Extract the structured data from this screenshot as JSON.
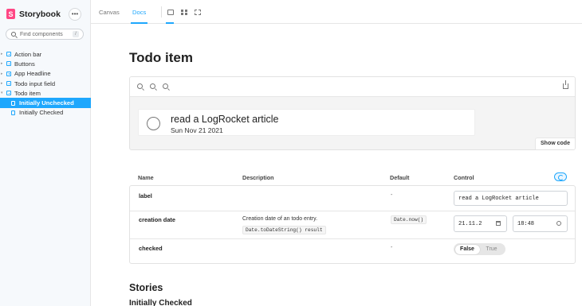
{
  "app": {
    "logo_letter": "S",
    "name": "Storybook",
    "more_label": "•••"
  },
  "search": {
    "placeholder": "Find components",
    "shortcut": "/"
  },
  "sidebar": {
    "items": [
      {
        "label": "Action bar",
        "type": "component"
      },
      {
        "label": "Buttons",
        "type": "component"
      },
      {
        "label": "App Headline",
        "type": "component"
      },
      {
        "label": "Todo input field",
        "type": "component"
      },
      {
        "label": "Todo item",
        "type": "component",
        "expanded": true
      },
      {
        "label": "Initially Unchecked",
        "type": "story",
        "selected": true
      },
      {
        "label": "Initially Checked",
        "type": "story"
      }
    ]
  },
  "toolbar": {
    "tabs": [
      {
        "label": "Canvas"
      },
      {
        "label": "Docs",
        "active": true
      }
    ],
    "tools": [
      "image-icon",
      "grid-icon",
      "outline-icon"
    ]
  },
  "docs": {
    "title": "Todo item",
    "preview": {
      "todo_label": "read a LogRocket article",
      "todo_date": "Sun Nov 21 2021",
      "show_code": "Show code"
    },
    "args": {
      "headers": {
        "name": "Name",
        "description": "Description",
        "default": "Default",
        "control": "Control"
      },
      "rows": [
        {
          "name": "label",
          "description": "",
          "default": "-",
          "control_value": "read a LogRocket article"
        },
        {
          "name": "creation date",
          "description": "Creation date of an todo entry.",
          "description_code": "Date.toDateString() result",
          "default": "Date.now()",
          "date_value": "21.11.2",
          "time_value": "18:48"
        },
        {
          "name": "checked",
          "description": "",
          "default": "-",
          "toggle": {
            "on": "False",
            "off": "True"
          }
        }
      ]
    },
    "stories_title": "Stories",
    "stories_sub": "Initially Checked"
  },
  "colors": {
    "accent": "#1ea7fd",
    "brand": "#ff4785"
  }
}
